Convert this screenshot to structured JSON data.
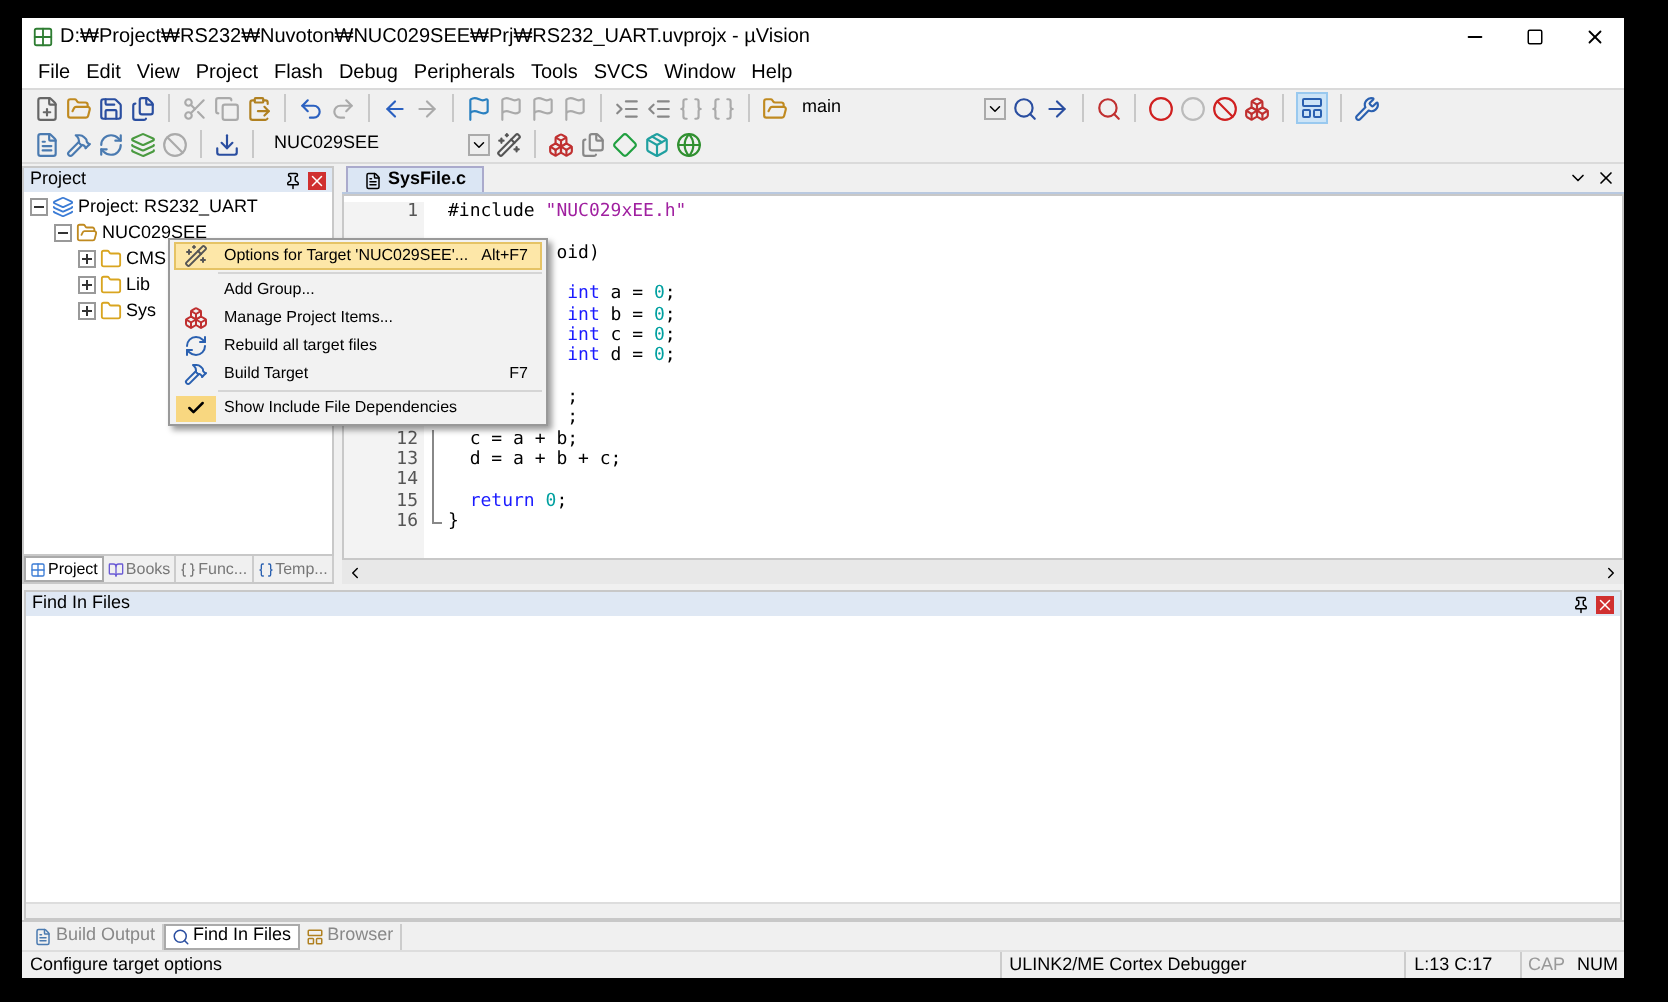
{
  "window": {
    "title": "D:₩Project₩RS232₩Nuvoton₩NUC029SEE₩Prj₩RS232_UART.uvprojx - µVision"
  },
  "menu_bar": [
    "File",
    "Edit",
    "View",
    "Project",
    "Flash",
    "Debug",
    "Peripherals",
    "Tools",
    "SVCS",
    "Window",
    "Help"
  ],
  "toolbar": {
    "find_combo": "main",
    "target_combo": "NUC029SEE"
  },
  "project_panel": {
    "title": "Project",
    "tree": [
      {
        "label": "Project: RS232_UART",
        "kind": "project",
        "expanded": true,
        "children": [
          {
            "label": "NUC029SEE",
            "kind": "target",
            "expanded": true,
            "children": [
              {
                "label": "CMS",
                "kind": "group",
                "expanded": false
              },
              {
                "label": "Lib",
                "kind": "group",
                "expanded": false
              },
              {
                "label": "Sys",
                "kind": "group",
                "expanded": false
              }
            ]
          }
        ]
      }
    ],
    "tabs": [
      {
        "label": "Project",
        "selected": true
      },
      {
        "label": "Books",
        "selected": false
      },
      {
        "label": "Func...",
        "selected": false
      },
      {
        "label": "Temp...",
        "selected": false
      }
    ]
  },
  "editor": {
    "tabs": [
      {
        "label": "SysFile.c",
        "selected": true
      }
    ],
    "blocks": [
      {
        "lines": [
          {
            "number": "1",
            "tokens": [
              {
                "kind": "preproc",
                "text": "#include "
              },
              {
                "kind": "string",
                "text": "\"NUC029xEE.h\""
              }
            ]
          }
        ]
      },
      {
        "lines": [
          {
            "tokens": [
              {
                "kind": "plain",
                "text": "          oid)"
              }
            ]
          }
        ]
      },
      {
        "lines": [
          {
            "tokens": [
              {
                "kind": "keyword",
                "text": "           int"
              },
              {
                "kind": "plain",
                "text": " a = "
              },
              {
                "kind": "number",
                "text": "0"
              },
              {
                "kind": "plain",
                "text": ";"
              }
            ]
          },
          {
            "tokens": [
              {
                "kind": "keyword",
                "text": "           int"
              },
              {
                "kind": "plain",
                "text": " b = "
              },
              {
                "kind": "number",
                "text": "0"
              },
              {
                "kind": "plain",
                "text": ";"
              }
            ]
          },
          {
            "tokens": [
              {
                "kind": "keyword",
                "text": "           int"
              },
              {
                "kind": "plain",
                "text": " c = "
              },
              {
                "kind": "number",
                "text": "0"
              },
              {
                "kind": "plain",
                "text": ";"
              }
            ]
          },
          {
            "tokens": [
              {
                "kind": "keyword",
                "text": "           int"
              },
              {
                "kind": "plain",
                "text": " d = "
              },
              {
                "kind": "number",
                "text": "0"
              },
              {
                "kind": "plain",
                "text": ";"
              }
            ]
          }
        ]
      },
      {
        "lines": [
          {
            "tokens": [
              {
                "kind": "plain",
                "text": "           ;"
              }
            ]
          },
          {
            "tokens": [
              {
                "kind": "plain",
                "text": "           ;"
              }
            ]
          },
          {
            "number": "12",
            "in_fold": true,
            "tokens": [
              {
                "kind": "plain",
                "text": "  c = a + b;"
              }
            ]
          },
          {
            "number": "13",
            "in_fold": true,
            "tokens": [
              {
                "kind": "plain",
                "text": "  d = a + b + c;"
              }
            ]
          },
          {
            "number": "14",
            "in_fold": true
          },
          {
            "number": "15",
            "in_fold": true,
            "tokens": [
              {
                "kind": "keyword",
                "text": "  return "
              },
              {
                "kind": "number",
                "text": "0"
              },
              {
                "kind": "plain",
                "text": ";"
              }
            ]
          },
          {
            "number": "16",
            "fold_end": true,
            "tokens": [
              {
                "kind": "plain",
                "text": "}"
              }
            ]
          }
        ]
      }
    ]
  },
  "context_menu": {
    "items": [
      {
        "kind": "item",
        "label": "Options for Target 'NUC029SEE'...",
        "shortcut": "Alt+F7",
        "highlighted": true,
        "checked": false
      },
      {
        "kind": "separator"
      },
      {
        "kind": "item",
        "label": "Add Group...",
        "highlighted": false,
        "checked": false
      },
      {
        "kind": "item",
        "label": "Manage Project Items...",
        "highlighted": false,
        "checked": false
      },
      {
        "kind": "item",
        "label": "Rebuild all target files",
        "highlighted": false,
        "checked": false
      },
      {
        "kind": "item",
        "label": "Build Target",
        "shortcut": "F7",
        "highlighted": false,
        "checked": false
      },
      {
        "kind": "separator"
      },
      {
        "kind": "item",
        "label": "Show Include File Dependencies",
        "highlighted": false,
        "checked": true
      }
    ]
  },
  "find_panel": {
    "title": "Find In Files"
  },
  "bottom_tabs": [
    {
      "label": "Build Output",
      "selected": false
    },
    {
      "label": "Find In Files",
      "selected": true
    },
    {
      "label": "Browser",
      "selected": false
    }
  ],
  "status_bar": {
    "message": "Configure target options",
    "debugger": "ULINK2/ME Cortex Debugger",
    "position": "L:13 C:17",
    "caps": "CAP",
    "caps_on": false,
    "num": "NUM",
    "num_on": true
  }
}
